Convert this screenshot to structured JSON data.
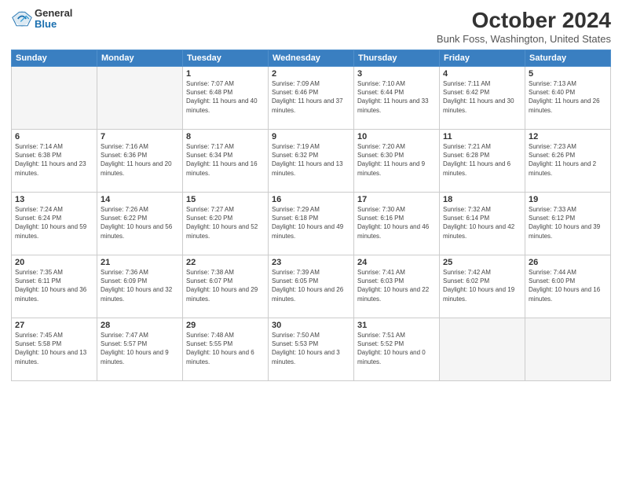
{
  "header": {
    "logo_general": "General",
    "logo_blue": "Blue",
    "title": "October 2024",
    "location": "Bunk Foss, Washington, United States"
  },
  "weekdays": [
    "Sunday",
    "Monday",
    "Tuesday",
    "Wednesday",
    "Thursday",
    "Friday",
    "Saturday"
  ],
  "weeks": [
    [
      {
        "day": "",
        "info": ""
      },
      {
        "day": "",
        "info": ""
      },
      {
        "day": "1",
        "info": "Sunrise: 7:07 AM\nSunset: 6:48 PM\nDaylight: 11 hours and 40 minutes."
      },
      {
        "day": "2",
        "info": "Sunrise: 7:09 AM\nSunset: 6:46 PM\nDaylight: 11 hours and 37 minutes."
      },
      {
        "day": "3",
        "info": "Sunrise: 7:10 AM\nSunset: 6:44 PM\nDaylight: 11 hours and 33 minutes."
      },
      {
        "day": "4",
        "info": "Sunrise: 7:11 AM\nSunset: 6:42 PM\nDaylight: 11 hours and 30 minutes."
      },
      {
        "day": "5",
        "info": "Sunrise: 7:13 AM\nSunset: 6:40 PM\nDaylight: 11 hours and 26 minutes."
      }
    ],
    [
      {
        "day": "6",
        "info": "Sunrise: 7:14 AM\nSunset: 6:38 PM\nDaylight: 11 hours and 23 minutes."
      },
      {
        "day": "7",
        "info": "Sunrise: 7:16 AM\nSunset: 6:36 PM\nDaylight: 11 hours and 20 minutes."
      },
      {
        "day": "8",
        "info": "Sunrise: 7:17 AM\nSunset: 6:34 PM\nDaylight: 11 hours and 16 minutes."
      },
      {
        "day": "9",
        "info": "Sunrise: 7:19 AM\nSunset: 6:32 PM\nDaylight: 11 hours and 13 minutes."
      },
      {
        "day": "10",
        "info": "Sunrise: 7:20 AM\nSunset: 6:30 PM\nDaylight: 11 hours and 9 minutes."
      },
      {
        "day": "11",
        "info": "Sunrise: 7:21 AM\nSunset: 6:28 PM\nDaylight: 11 hours and 6 minutes."
      },
      {
        "day": "12",
        "info": "Sunrise: 7:23 AM\nSunset: 6:26 PM\nDaylight: 11 hours and 2 minutes."
      }
    ],
    [
      {
        "day": "13",
        "info": "Sunrise: 7:24 AM\nSunset: 6:24 PM\nDaylight: 10 hours and 59 minutes."
      },
      {
        "day": "14",
        "info": "Sunrise: 7:26 AM\nSunset: 6:22 PM\nDaylight: 10 hours and 56 minutes."
      },
      {
        "day": "15",
        "info": "Sunrise: 7:27 AM\nSunset: 6:20 PM\nDaylight: 10 hours and 52 minutes."
      },
      {
        "day": "16",
        "info": "Sunrise: 7:29 AM\nSunset: 6:18 PM\nDaylight: 10 hours and 49 minutes."
      },
      {
        "day": "17",
        "info": "Sunrise: 7:30 AM\nSunset: 6:16 PM\nDaylight: 10 hours and 46 minutes."
      },
      {
        "day": "18",
        "info": "Sunrise: 7:32 AM\nSunset: 6:14 PM\nDaylight: 10 hours and 42 minutes."
      },
      {
        "day": "19",
        "info": "Sunrise: 7:33 AM\nSunset: 6:12 PM\nDaylight: 10 hours and 39 minutes."
      }
    ],
    [
      {
        "day": "20",
        "info": "Sunrise: 7:35 AM\nSunset: 6:11 PM\nDaylight: 10 hours and 36 minutes."
      },
      {
        "day": "21",
        "info": "Sunrise: 7:36 AM\nSunset: 6:09 PM\nDaylight: 10 hours and 32 minutes."
      },
      {
        "day": "22",
        "info": "Sunrise: 7:38 AM\nSunset: 6:07 PM\nDaylight: 10 hours and 29 minutes."
      },
      {
        "day": "23",
        "info": "Sunrise: 7:39 AM\nSunset: 6:05 PM\nDaylight: 10 hours and 26 minutes."
      },
      {
        "day": "24",
        "info": "Sunrise: 7:41 AM\nSunset: 6:03 PM\nDaylight: 10 hours and 22 minutes."
      },
      {
        "day": "25",
        "info": "Sunrise: 7:42 AM\nSunset: 6:02 PM\nDaylight: 10 hours and 19 minutes."
      },
      {
        "day": "26",
        "info": "Sunrise: 7:44 AM\nSunset: 6:00 PM\nDaylight: 10 hours and 16 minutes."
      }
    ],
    [
      {
        "day": "27",
        "info": "Sunrise: 7:45 AM\nSunset: 5:58 PM\nDaylight: 10 hours and 13 minutes."
      },
      {
        "day": "28",
        "info": "Sunrise: 7:47 AM\nSunset: 5:57 PM\nDaylight: 10 hours and 9 minutes."
      },
      {
        "day": "29",
        "info": "Sunrise: 7:48 AM\nSunset: 5:55 PM\nDaylight: 10 hours and 6 minutes."
      },
      {
        "day": "30",
        "info": "Sunrise: 7:50 AM\nSunset: 5:53 PM\nDaylight: 10 hours and 3 minutes."
      },
      {
        "day": "31",
        "info": "Sunrise: 7:51 AM\nSunset: 5:52 PM\nDaylight: 10 hours and 0 minutes."
      },
      {
        "day": "",
        "info": ""
      },
      {
        "day": "",
        "info": ""
      }
    ]
  ]
}
